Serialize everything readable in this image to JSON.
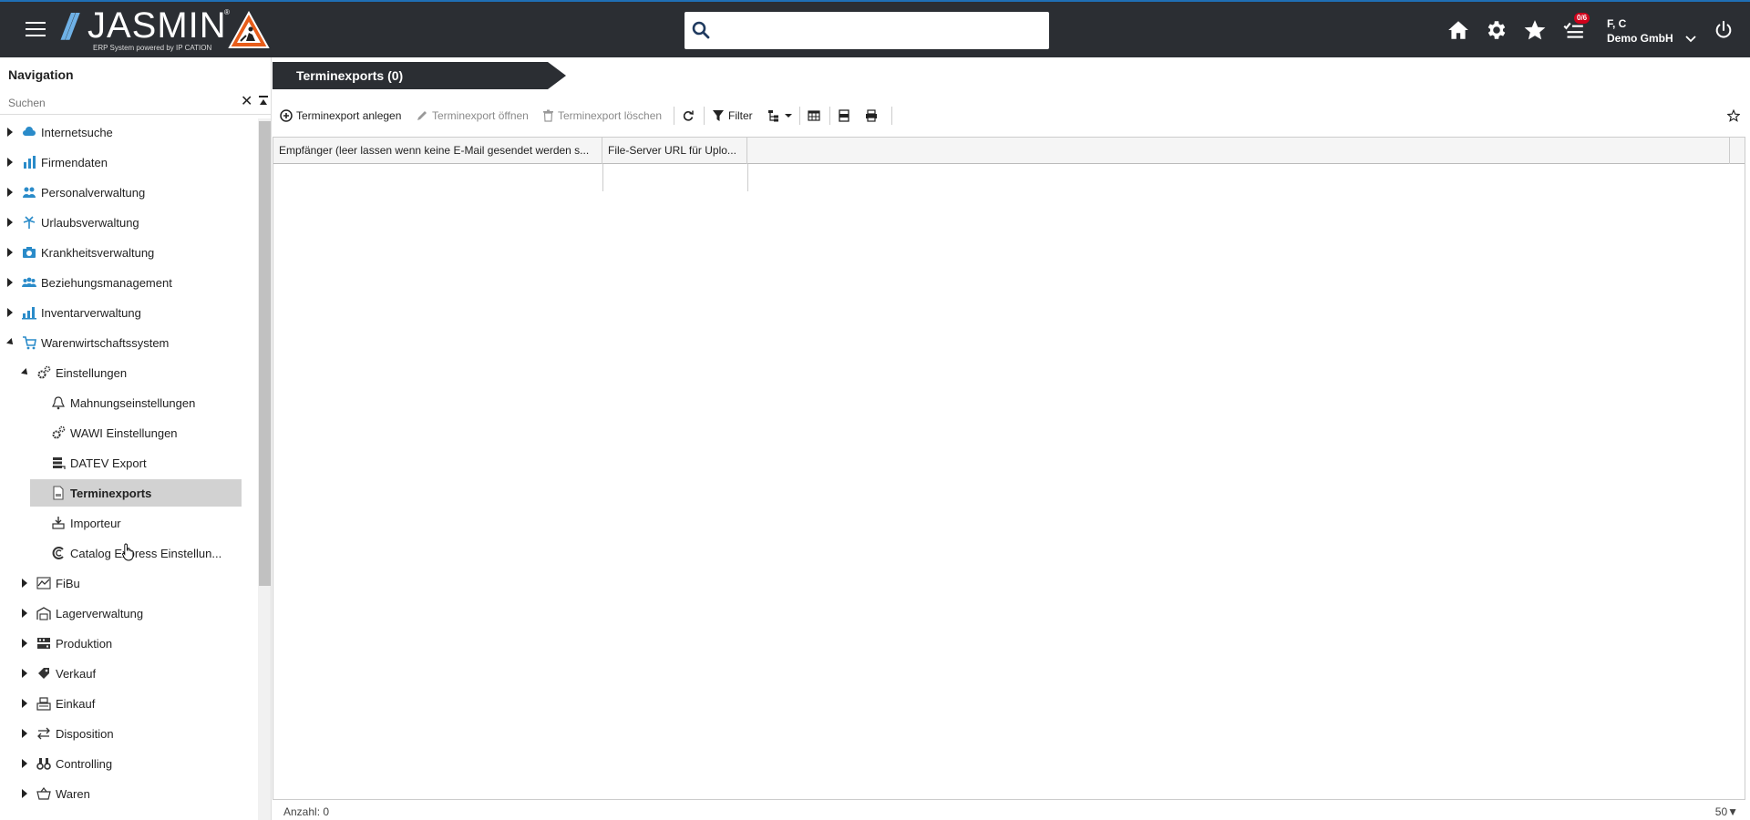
{
  "header": {
    "logo_slashes": "//",
    "logo_text": "JASMIN",
    "logo_reg": "®",
    "logo_subtitle": "ERP System powered by IP CATION",
    "search_placeholder": "",
    "tasks_badge": "0/6",
    "user_name": "F, C",
    "user_company": "Demo GmbH"
  },
  "sidebar": {
    "title": "Navigation",
    "search_placeholder": "Suchen",
    "clear_label": "✕",
    "items": [
      {
        "label": "Internetsuche",
        "icon": "cloud-search-icon",
        "level": 0,
        "expanded": false
      },
      {
        "label": "Firmendaten",
        "icon": "building-chart-icon",
        "level": 0,
        "expanded": false
      },
      {
        "label": "Personalverwaltung",
        "icon": "people-icon",
        "level": 0,
        "expanded": false
      },
      {
        "label": "Urlaubsverwaltung",
        "icon": "palm-tree-icon",
        "level": 0,
        "expanded": false
      },
      {
        "label": "Krankheitsverwaltung",
        "icon": "camera-icon",
        "level": 0,
        "expanded": false
      },
      {
        "label": "Beziehungsmanagement",
        "icon": "group-icon",
        "level": 0,
        "expanded": false
      },
      {
        "label": "Inventarverwaltung",
        "icon": "factory-chart-icon",
        "level": 0,
        "expanded": false
      },
      {
        "label": "Warenwirtschaftssystem",
        "icon": "cart-icon",
        "level": 0,
        "expanded": true
      },
      {
        "label": "Einstellungen",
        "icon": "gears-icon",
        "level": 1,
        "expanded": true
      },
      {
        "label": "Mahnungseinstellungen",
        "icon": "bell-icon",
        "level": 2
      },
      {
        "label": "WAWI Einstellungen",
        "icon": "gears-icon",
        "level": 2
      },
      {
        "label": "DATEV Export",
        "icon": "database-export-icon",
        "level": 2
      },
      {
        "label": "Terminexports",
        "icon": "document-csv-icon",
        "level": 2,
        "selected": true
      },
      {
        "label": "Importeur",
        "icon": "importer-icon",
        "level": 2
      },
      {
        "label": "Catalog Express Einstellun...",
        "icon": "catalog-c-icon",
        "level": 2
      },
      {
        "label": "FiBu",
        "icon": "chart-line-icon",
        "level": 1,
        "expanded": false
      },
      {
        "label": "Lagerverwaltung",
        "icon": "warehouse-icon",
        "level": 1,
        "expanded": false
      },
      {
        "label": "Produktion",
        "icon": "production-icon",
        "level": 1,
        "expanded": false
      },
      {
        "label": "Verkauf",
        "icon": "tag-icon",
        "level": 1,
        "expanded": false
      },
      {
        "label": "Einkauf",
        "icon": "register-icon",
        "level": 1,
        "expanded": false
      },
      {
        "label": "Disposition",
        "icon": "swap-arrows-icon",
        "level": 1,
        "expanded": false
      },
      {
        "label": "Controlling",
        "icon": "binoculars-icon",
        "level": 1,
        "expanded": false
      },
      {
        "label": "Waren",
        "icon": "basket-icon",
        "level": 1,
        "expanded": false
      }
    ]
  },
  "main": {
    "tab_title": "Terminexports (0)",
    "toolbar": {
      "create": "Terminexport anlegen",
      "open": "Terminexport öffnen",
      "delete": "Terminexport löschen",
      "filter": "Filter"
    },
    "columns": [
      "Empfänger (leer lassen wenn keine E-Mail gesendet werden s...",
      "File-Server URL für Uplo..."
    ],
    "footer_count": "Anzahl: 0",
    "page_size": "50▼"
  },
  "colors": {
    "topbar": "#2b2e33",
    "accent_icon": "#2a8bc9",
    "badge": "#d0021b",
    "selected_row": "#d2d2d2"
  }
}
